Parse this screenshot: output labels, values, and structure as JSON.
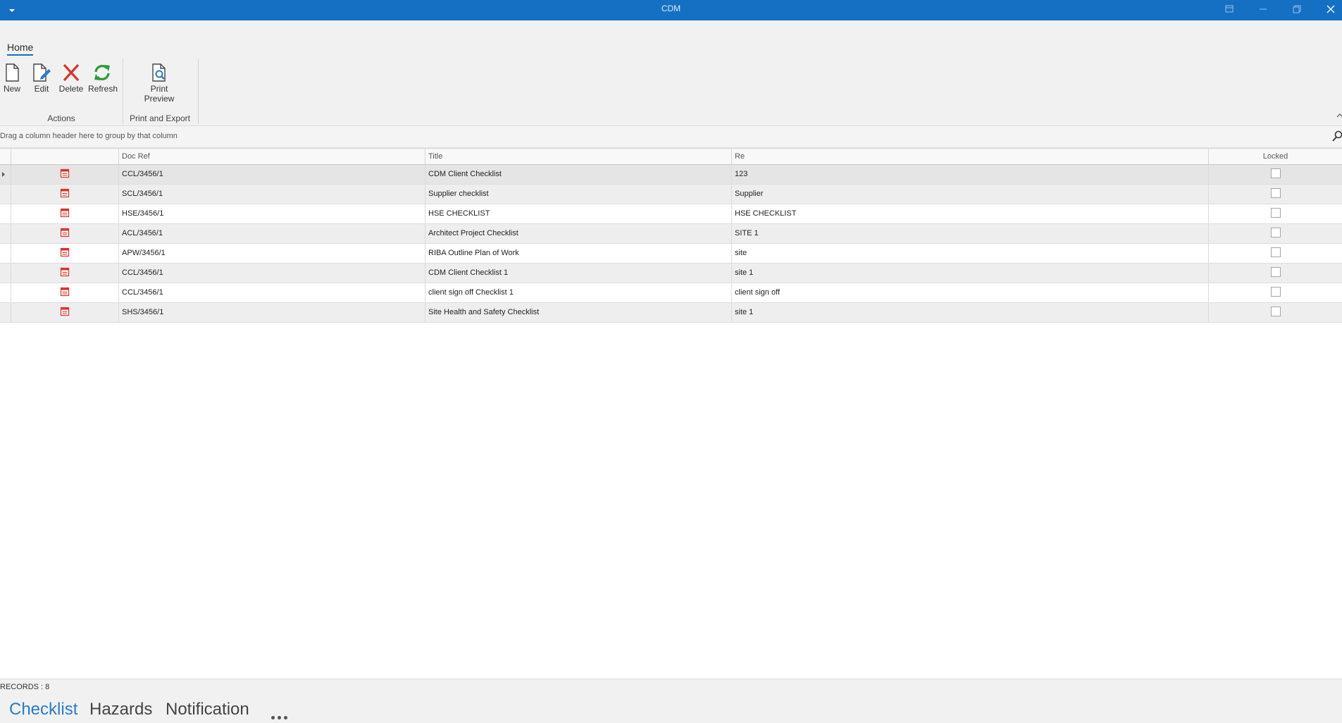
{
  "window": {
    "title": "CDM",
    "menu_icon": "dropdown-arrow-icon",
    "controls": [
      "restore-mini-icon",
      "minimize-icon",
      "maximize-icon",
      "close-icon"
    ]
  },
  "ribbon": {
    "tabs": [
      {
        "label": "Home",
        "active": true
      }
    ],
    "groups": [
      {
        "label": "Actions",
        "buttons": [
          {
            "label": "New",
            "icon": "new-document-icon"
          },
          {
            "label": "Edit",
            "icon": "edit-document-icon"
          },
          {
            "label": "Delete",
            "icon": "delete-x-icon"
          },
          {
            "label": "Refresh",
            "icon": "refresh-icon"
          }
        ]
      },
      {
        "label": "Print and Export",
        "buttons": [
          {
            "label": "Print Preview",
            "line1": "Print",
            "line2": "Preview",
            "icon": "print-preview-icon"
          }
        ]
      }
    ]
  },
  "group_panel": {
    "hint": "Drag a column header here to group by that column"
  },
  "grid": {
    "columns": [
      "",
      "Doc Ref",
      "Title",
      "Re",
      "Locked"
    ],
    "rows": [
      {
        "doc_ref": "CCL/3456/1",
        "title": "CDM Client Checklist",
        "re": "123",
        "locked": false
      },
      {
        "doc_ref": "SCL/3456/1",
        "title": "Supplier checklist",
        "re": "Supplier",
        "locked": false
      },
      {
        "doc_ref": "HSE/3456/1",
        "title": "HSE CHECKLIST",
        "re": "HSE CHECKLIST",
        "locked": false
      },
      {
        "doc_ref": "ACL/3456/1",
        "title": "Architect Project Checklist",
        "re": "SITE 1",
        "locked": false
      },
      {
        "doc_ref": "APW/3456/1",
        "title": "RIBA Outline Plan of Work",
        "re": "site",
        "locked": false
      },
      {
        "doc_ref": "CCL/3456/1",
        "title": "CDM Client Checklist 1",
        "re": "site 1",
        "locked": false
      },
      {
        "doc_ref": "CCL/3456/1",
        "title": "client sign off Checklist 1",
        "re": "client sign off",
        "locked": false
      },
      {
        "doc_ref": "SHS/3456/1",
        "title": "Site Health and Safety Checklist",
        "re": "site 1",
        "locked": false
      }
    ]
  },
  "status": {
    "records": "RECORDS : 8"
  },
  "nav": {
    "items": [
      {
        "label": "Checklist",
        "active": true
      },
      {
        "label": "Hazards",
        "active": false
      },
      {
        "label": "Notification",
        "active": false
      }
    ],
    "more_icon": "more-dots-icon"
  },
  "colors": {
    "titlebar": "#1570c4",
    "nav_active": "#2a7ac6",
    "delete_red": "#d9342b",
    "refresh_green": "#2c9b3a",
    "doc_icon_red": "#d9342b"
  }
}
